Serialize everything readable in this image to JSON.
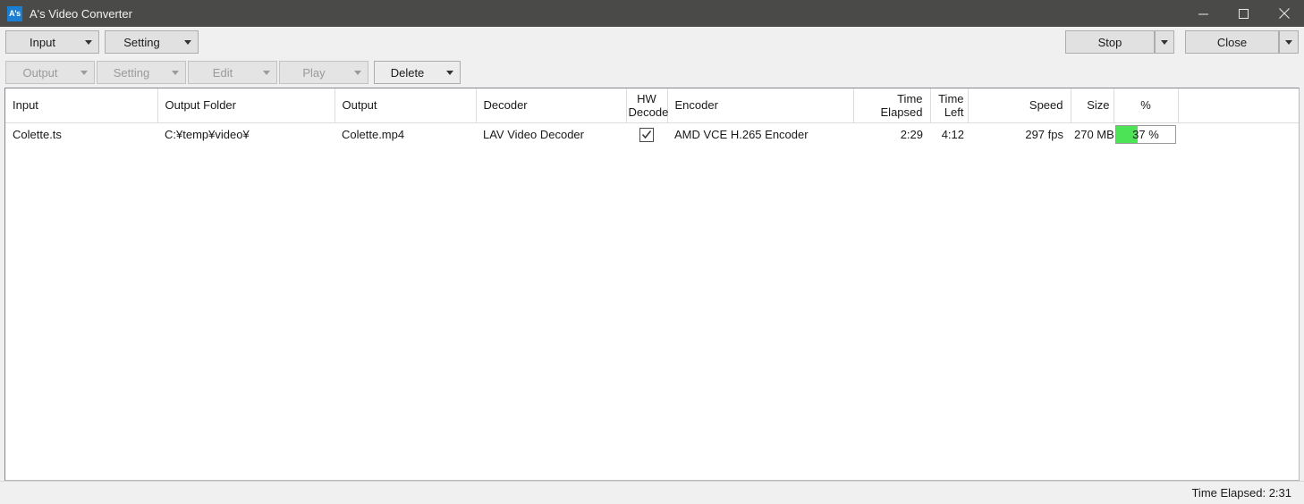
{
  "window": {
    "title": "A's Video Converter",
    "icon_label": "A's",
    "minimize_icon": "minimize-icon",
    "maximize_icon": "maximize-icon",
    "close_icon": "close-icon"
  },
  "toolbar_top": {
    "input_label": "Input",
    "setting_label": "Setting",
    "stop_label": "Stop",
    "close_label": "Close"
  },
  "toolbar_second": {
    "output_label": "Output",
    "setting_label": "Setting",
    "edit_label": "Edit",
    "play_label": "Play",
    "delete_label": "Delete"
  },
  "grid": {
    "columns": [
      {
        "key": "input",
        "label": "Input",
        "align": "left"
      },
      {
        "key": "output_folder",
        "label": "Output Folder",
        "align": "left"
      },
      {
        "key": "output",
        "label": "Output",
        "align": "left"
      },
      {
        "key": "decoder",
        "label": "Decoder",
        "align": "left"
      },
      {
        "key": "hw_decode",
        "label": "HW\nDecode",
        "align": "center"
      },
      {
        "key": "encoder",
        "label": "Encoder",
        "align": "left"
      },
      {
        "key": "time_elapsed",
        "label": "Time\nElapsed",
        "align": "right"
      },
      {
        "key": "time_left",
        "label": "Time\nLeft",
        "align": "right"
      },
      {
        "key": "speed",
        "label": "Speed",
        "align": "right"
      },
      {
        "key": "size",
        "label": "Size",
        "align": "right"
      },
      {
        "key": "percent",
        "label": "%",
        "align": "center"
      }
    ],
    "header": {
      "input": "Input",
      "output_folder": "Output Folder",
      "output": "Output",
      "decoder": "Decoder",
      "hw_decode_line1": "HW",
      "hw_decode_line2": "Decode",
      "encoder": "Encoder",
      "time_elapsed_line1": "Time",
      "time_elapsed_line2": "Elapsed",
      "time_left_line1": "Time",
      "time_left_line2": "Left",
      "speed": "Speed",
      "size": "Size",
      "percent": "%"
    },
    "rows": [
      {
        "input": "Colette.ts",
        "output_folder": "C:¥temp¥video¥",
        "output": "Colette.mp4",
        "decoder": "LAV Video Decoder",
        "hw_decode_checked": true,
        "encoder": "AMD VCE H.265 Encoder",
        "time_elapsed": "2:29",
        "time_left": "4:12",
        "speed": "297 fps",
        "size": "270 MB",
        "percent_text": "37 %",
        "percent_value": 37
      }
    ]
  },
  "statusbar": {
    "text": "Time Elapsed: 2:31"
  },
  "colors": {
    "titlebar_bg": "#4a4a48",
    "progress_fill": "#4ce357",
    "app_icon_bg": "#1a7fd4",
    "chrome_bg": "#f0f0f0"
  }
}
